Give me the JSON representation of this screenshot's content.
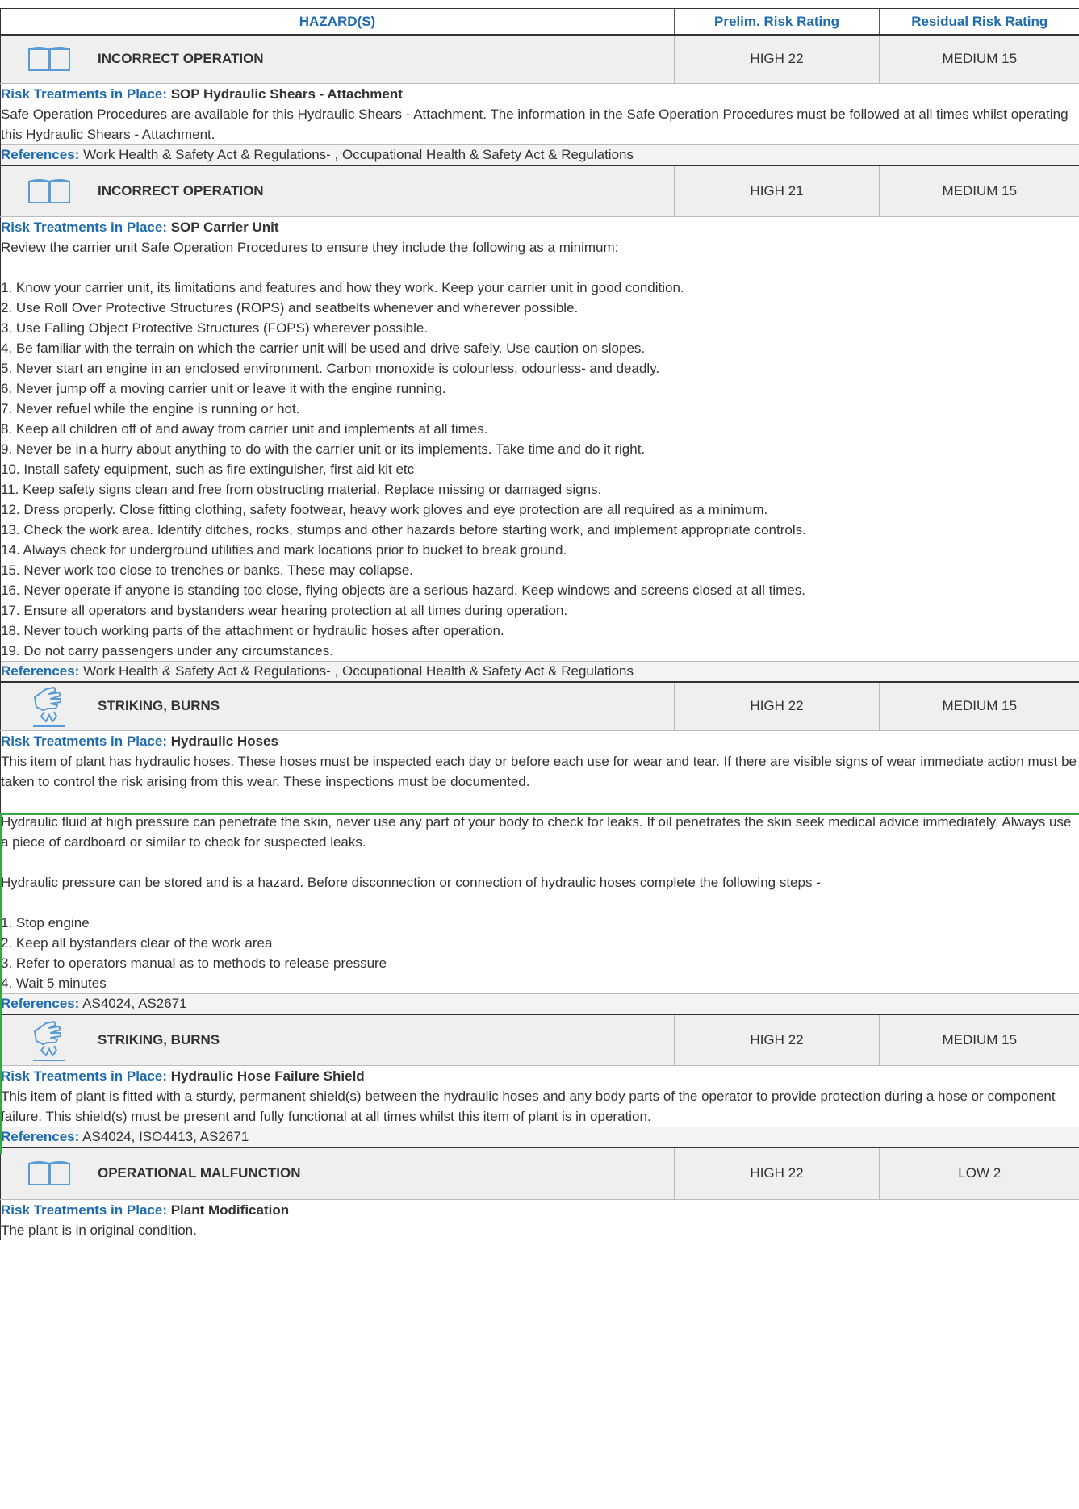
{
  "header": {
    "hazard_col": "HAZARD(S)",
    "prelim_col": "Prelim. Risk Rating",
    "residual_col": "Residual Risk Rating"
  },
  "labels": {
    "treatments": "Risk Treatments in Place:",
    "references": "References:"
  },
  "hazards": [
    {
      "icon": "book-icon",
      "title": "INCORRECT OPERATION",
      "prelim": "HIGH 22",
      "residual": "MEDIUM 15",
      "treatment_name": "SOP Hydraulic Shears - Attachment",
      "treatment_body": "Safe Operation Procedures are available for this Hydraulic Shears - Attachment. The information in the Safe Operation Procedures must be followed at all times whilst operating this Hydraulic Shears - Attachment.",
      "references": "Work Health & Safety Act & Regulations- , Occupational Health & Safety Act & Regulations"
    },
    {
      "icon": "book-icon",
      "title": "INCORRECT OPERATION",
      "prelim": "HIGH 21",
      "residual": "MEDIUM 15",
      "treatment_name": "SOP Carrier Unit",
      "treatment_body": "Review the carrier unit Safe Operation Procedures to ensure they include the following as a minimum:\n\n1. Know your carrier unit, its limitations and features and how they work. Keep your carrier unit in good condition.\n2. Use Roll Over Protective Structures (ROPS) and seatbelts whenever and wherever possible.\n3. Use Falling Object Protective Structures (FOPS) wherever possible.\n4. Be familiar with the terrain on which the carrier unit will be used and drive safely. Use caution on slopes.\n5. Never start an engine in an enclosed environment. Carbon monoxide is colourless, odourless- and deadly.\n6. Never jump off a moving carrier unit or leave it with the engine running.\n7. Never refuel while the engine is running or hot.\n8. Keep all children off of and away from carrier unit and implements at all times.\n9. Never be in a hurry about anything to do with the carrier unit or its implements. Take time and do it right.\n10. Install safety equipment, such as fire extinguisher, first aid kit etc\n11. Keep safety signs clean and free from obstructing material. Replace missing or damaged signs.\n12. Dress properly. Close fitting clothing, safety footwear, heavy work gloves and eye protection are all required as a minimum.\n13. Check the work area. Identify ditches, rocks, stumps and other hazards before starting work, and implement appropriate controls.\n14. Always check for underground utilities and mark locations prior to bucket to break ground.\n15. Never work too close to trenches or banks. These may collapse.\n16. Never operate if anyone is standing too close, flying objects are a serious hazard. Keep windows and screens closed at all times.\n17. Ensure all operators and bystanders wear hearing protection at all times during operation.\n18. Never touch working parts of the attachment or hydraulic hoses after operation.\n19. Do not carry passengers under any circumstances.",
      "references": "Work Health & Safety Act & Regulations- , Occupational Health & Safety Act & Regulations"
    },
    {
      "icon": "hand-burn-icon",
      "title": "STRIKING, BURNS",
      "prelim": "HIGH 22",
      "residual": "MEDIUM 15",
      "treatment_name": "Hydraulic Hoses",
      "treatment_body": "This item of plant has hydraulic hoses. These hoses must be inspected each day or before each use for wear and tear. If there are visible signs of wear immediate action must be taken to control the risk arising from this wear. These inspections must be documented.\n\nHydraulic fluid at high pressure can penetrate the skin, never use any part of your body to check for leaks. If oil penetrates the skin seek medical advice immediately. Always use a piece of cardboard or similar to check for suspected leaks.\n\nHydraulic pressure can be stored and is a hazard. Before disconnection or connection of hydraulic hoses complete the following steps -\n\n1. Stop engine\n2. Keep all bystanders clear of the work area\n3. Refer to operators manual as to methods to release pressure\n4. Wait 5 minutes",
      "references": "AS4024, AS2671"
    },
    {
      "icon": "hand-burn-icon",
      "title": "STRIKING, BURNS",
      "prelim": "HIGH 22",
      "residual": "MEDIUM 15",
      "treatment_name": "Hydraulic Hose Failure Shield",
      "treatment_body": "This item of plant is fitted with a sturdy, permanent shield(s) between the hydraulic hoses and any body parts of the operator to provide protection during a hose or component failure. This shield(s) must be present and fully functional at all times whilst this item of plant is in operation.",
      "references": "AS4024, ISO4413, AS2671"
    },
    {
      "icon": "book-icon",
      "title": "OPERATIONAL MALFUNCTION",
      "prelim": "HIGH 22",
      "residual": "LOW 2",
      "treatment_name": "Plant Modification",
      "treatment_body": "The plant is in original condition.",
      "references": ""
    }
  ]
}
